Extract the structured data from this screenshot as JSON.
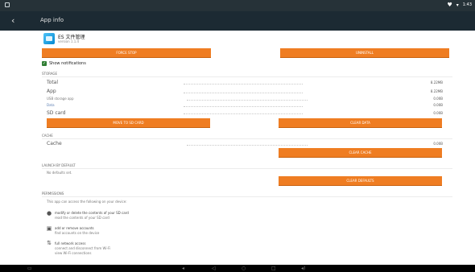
{
  "status_bar": {
    "time": "1:43"
  },
  "action_bar": {
    "title": "App info"
  },
  "app": {
    "name": "ES 文件管理",
    "version": "version 1.1.4"
  },
  "buttons": {
    "force_stop": "FORCE STOP",
    "uninstall": "UNINSTALL",
    "move_to_sd": "MOVE TO SD CARD",
    "clear_data": "CLEAR DATA",
    "clear_cache": "CLEAR CACHE",
    "clear_defaults": "CLEAR DEFAULTS"
  },
  "notifications": {
    "label": "Show notifications",
    "checked": true
  },
  "storage": {
    "header": "STORAGE",
    "rows": [
      {
        "label": "Total",
        "value": "8.22MB"
      },
      {
        "label": "App",
        "value": "8.22MB"
      },
      {
        "label": "USB storage app",
        "value": "0.00B"
      },
      {
        "label": "Data",
        "value": "0.00B"
      },
      {
        "label": "SD card",
        "value": "0.00B"
      }
    ]
  },
  "cache": {
    "header": "CACHE",
    "label": "Cache",
    "value": "0.00B"
  },
  "launch": {
    "header": "LAUNCH BY DEFAULT",
    "text": "No defaults set."
  },
  "permissions": {
    "header": "PERMISSIONS",
    "intro": "This app can access the following on your device:",
    "items": [
      {
        "icon": "storage-icon",
        "title": "modify or delete the contents of your SD card",
        "desc": "read the contents of your SD card"
      },
      {
        "icon": "accounts-icon",
        "title": "add or remove accounts",
        "desc": "find accounts on the device"
      },
      {
        "icon": "network-icon",
        "title": "full network access",
        "desc": "connect and disconnect from Wi-Fi"
      },
      {
        "icon": "wifi-icon",
        "title": "",
        "desc": "view Wi-Fi connections"
      }
    ]
  },
  "colors": {
    "accent": "#ef7d22",
    "action_bar": "#1c2a33",
    "status_bar": "#263238"
  }
}
